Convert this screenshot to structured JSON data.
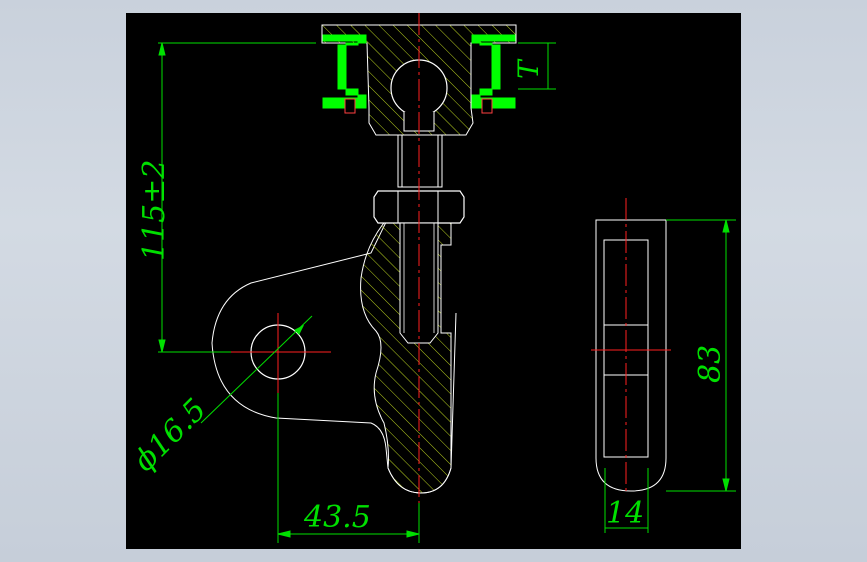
{
  "colors": {
    "background": "#c9d1dc",
    "viewport": "#000000",
    "outline": "#ffffff",
    "dimension": "#00e000",
    "centerline": "#ff2020",
    "hatch": "#b8d020",
    "channel": "#00ff00"
  },
  "dimensions": {
    "height": "115±2",
    "diameter": "ϕ16.5",
    "offset": "43.5",
    "thickness": "T",
    "side_height": "83",
    "side_width": "14"
  }
}
